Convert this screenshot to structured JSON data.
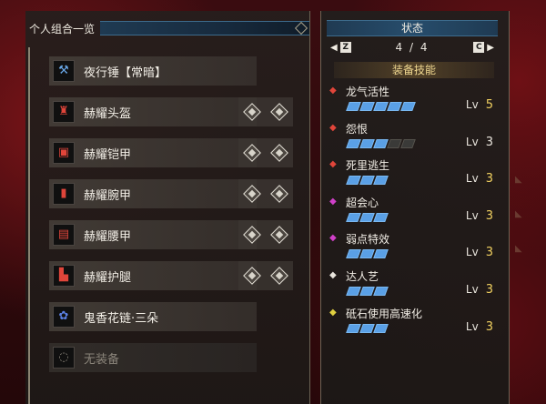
{
  "left": {
    "title": "个人组合一览",
    "equipment": [
      {
        "label": "夜行锤【常暗】",
        "icon": "hammer-icon",
        "glyph": "⚒",
        "slots": 0
      },
      {
        "label": "赫耀头盔",
        "icon": "helmet-icon",
        "glyph": "♜",
        "slots": 2
      },
      {
        "label": "赫耀铠甲",
        "icon": "chest-armor-icon",
        "glyph": "▣",
        "slots": 2
      },
      {
        "label": "赫耀腕甲",
        "icon": "arm-armor-icon",
        "glyph": "▮",
        "slots": 2
      },
      {
        "label": "赫耀腰甲",
        "icon": "waist-armor-icon",
        "glyph": "▤",
        "slots": 2
      },
      {
        "label": "赫耀护腿",
        "icon": "leg-armor-icon",
        "glyph": "▙",
        "slots": 2
      },
      {
        "label": "鬼香花链·三朵",
        "icon": "charm-icon",
        "glyph": "✿",
        "slots": 0
      },
      {
        "label": "无装备",
        "icon": "empty-slot-icon",
        "glyph": "◌",
        "slots": 0
      }
    ]
  },
  "right": {
    "title": "状态",
    "pager": {
      "prev_key": "Z",
      "next_key": "C",
      "current": "4",
      "separator": "/",
      "total": "4"
    },
    "section_title": "装备技能",
    "skills": [
      {
        "name": "龙气活性",
        "level_label": "Lv",
        "level": "5",
        "pips_on": 5,
        "pips_total": 5,
        "color": "#e0453a",
        "max": true
      },
      {
        "name": "怨恨",
        "level_label": "Lv",
        "level": "3",
        "pips_on": 3,
        "pips_total": 5,
        "color": "#e0453a",
        "max": false
      },
      {
        "name": "死里逃生",
        "level_label": "Lv",
        "level": "3",
        "pips_on": 3,
        "pips_total": 3,
        "color": "#e0453a",
        "max": true
      },
      {
        "name": "超会心",
        "level_label": "Lv",
        "level": "3",
        "pips_on": 3,
        "pips_total": 3,
        "color": "#d040c8",
        "max": true
      },
      {
        "name": "弱点特效",
        "level_label": "Lv",
        "level": "3",
        "pips_on": 3,
        "pips_total": 3,
        "color": "#d040c8",
        "max": true
      },
      {
        "name": "达人艺",
        "level_label": "Lv",
        "level": "3",
        "pips_on": 3,
        "pips_total": 3,
        "color": "#e8e4dc",
        "max": true
      },
      {
        "name": "砥石使用高速化",
        "level_label": "Lv",
        "level": "3",
        "pips_on": 3,
        "pips_total": 3,
        "color": "#e0d040",
        "max": true
      }
    ]
  }
}
